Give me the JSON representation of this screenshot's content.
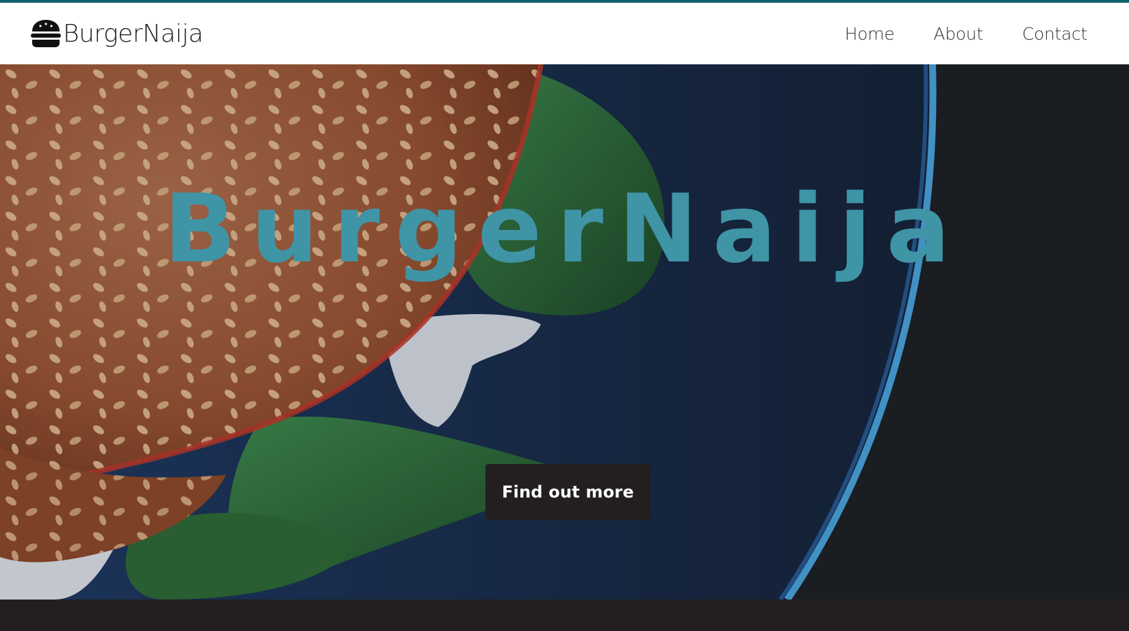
{
  "brand": {
    "name": "BurgerNaija",
    "icon": "burger-icon"
  },
  "nav": {
    "items": [
      {
        "label": "Home"
      },
      {
        "label": "About"
      },
      {
        "label": "Contact"
      }
    ]
  },
  "hero": {
    "title": "BurgerNaija",
    "cta_label": "Find out more"
  },
  "colors": {
    "accent": "#3f94a6",
    "topline": "#0f5f6e",
    "dark": "#231f20"
  }
}
